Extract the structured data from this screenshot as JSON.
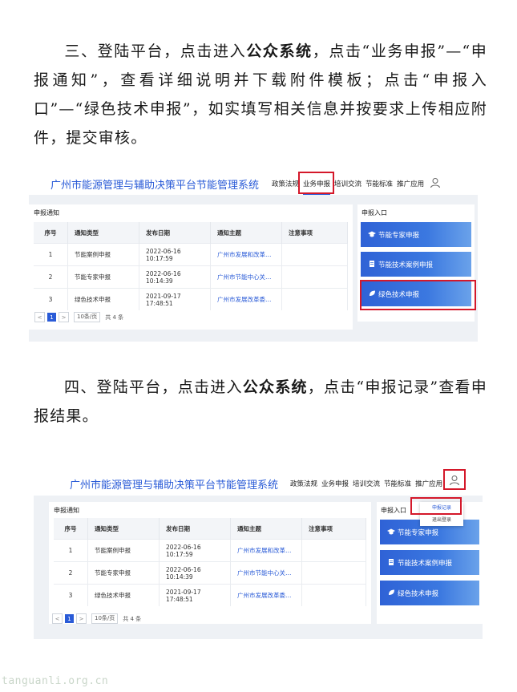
{
  "para3": {
    "lead": "三、登陆平台，点击进入",
    "bold": "公众系统",
    "rest": "，点击“业务申报”—“申报通知”，查看详细说明并下载附件模板；点击“申报入口”—“绿色技术申报”，如实填写相关信息并按要求上传相应附件，提交审核。"
  },
  "para4": {
    "lead": "四、登陆平台，点击进入",
    "bold": "公众系统",
    "rest": "，点击“申报记录”查看申报结果。"
  },
  "system": {
    "title": "广州市能源管理与辅助决策平台节能管理系统",
    "nav": [
      "政策法规",
      "业务申报",
      "培训交流",
      "节能标准",
      "推广应用"
    ]
  },
  "panel": {
    "title": "申报通知",
    "columns": [
      "序号",
      "通知类型",
      "发布日期",
      "通知主题",
      "注意事项"
    ],
    "rows": [
      {
        "no": "1",
        "type": "节能案例申报",
        "date": "2022-06-16 10:17:59",
        "topic": "广州市发展和改革…",
        "note": ""
      },
      {
        "no": "2",
        "type": "节能专家申报",
        "date": "2022-06-16 10:14:39",
        "topic": "广州市节能中心关…",
        "note": ""
      },
      {
        "no": "3",
        "type": "绿色技术申报",
        "date": "2021-09-17 17:48:51",
        "topic": "广州市发展改革委…",
        "note": ""
      }
    ],
    "pager": {
      "prev": "<",
      "current": "1",
      "next": ">",
      "size": "10条/页",
      "total": "共 4 条"
    }
  },
  "side": {
    "title": "申报入口",
    "cards": [
      "节能专家申报",
      "节能技术案例申报",
      "绿色技术申报"
    ]
  },
  "dropdown": {
    "items": [
      "申报记录",
      "退出登录"
    ]
  },
  "watermark": "tanguanli.org.cn",
  "colors": {
    "accent": "#2a5bd7",
    "highlight": "#d4182a"
  }
}
